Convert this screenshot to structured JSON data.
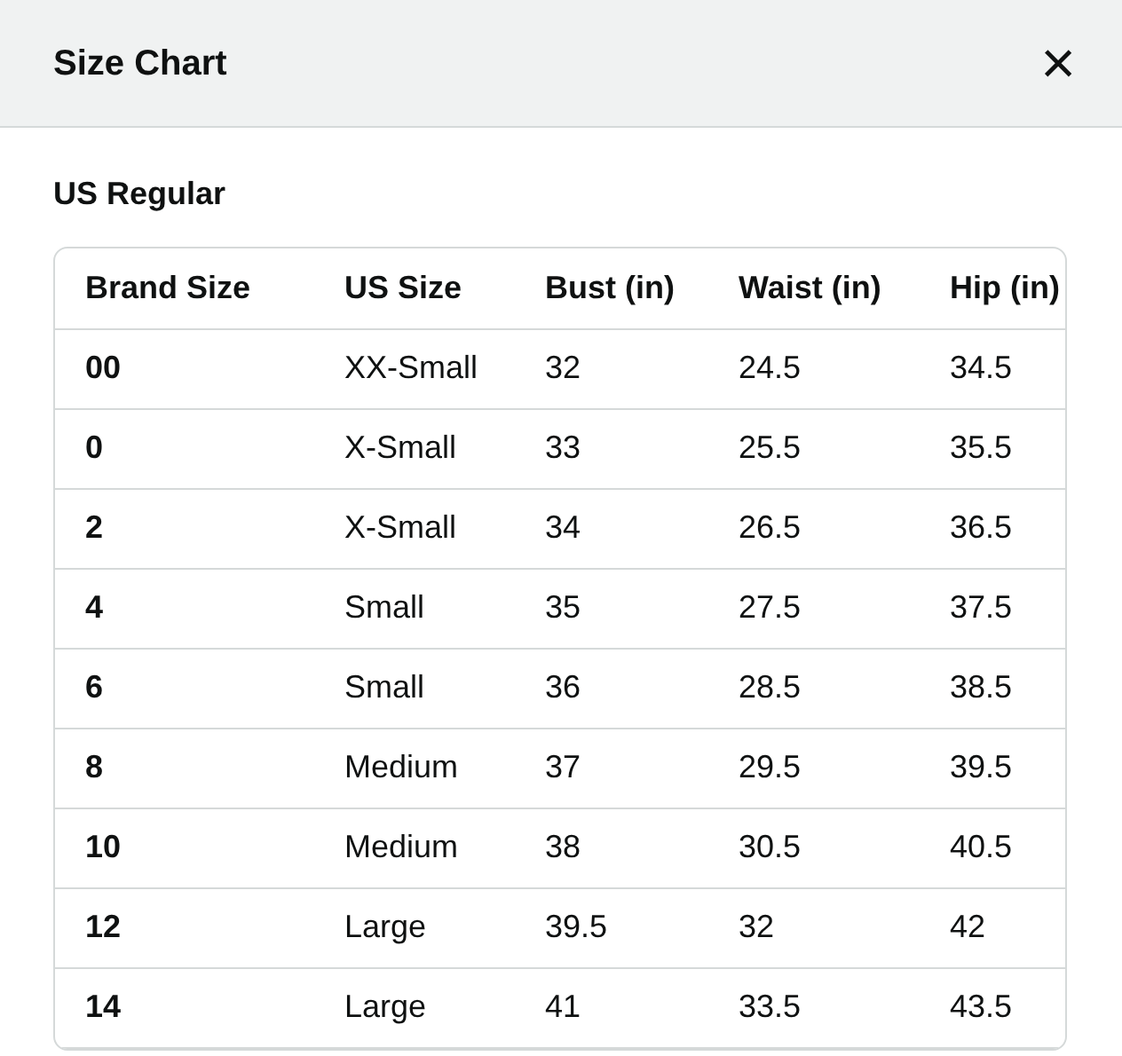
{
  "header": {
    "title": "Size Chart",
    "close": "×"
  },
  "section_title": "US Regular",
  "table": {
    "columns": [
      "Brand Size",
      "US Size",
      "Bust (in)",
      "Waist (in)",
      "Hip (in)"
    ],
    "rows": [
      [
        "00",
        "XX-Small",
        "32",
        "24.5",
        "34.5"
      ],
      [
        "0",
        "X-Small",
        "33",
        "25.5",
        "35.5"
      ],
      [
        "2",
        "X-Small",
        "34",
        "26.5",
        "36.5"
      ],
      [
        "4",
        "Small",
        "35",
        "27.5",
        "37.5"
      ],
      [
        "6",
        "Small",
        "36",
        "28.5",
        "38.5"
      ],
      [
        "8",
        "Medium",
        "37",
        "29.5",
        "39.5"
      ],
      [
        "10",
        "Medium",
        "38",
        "30.5",
        "40.5"
      ],
      [
        "12",
        "Large",
        "39.5",
        "32",
        "42"
      ],
      [
        "14",
        "Large",
        "41",
        "33.5",
        "43.5"
      ]
    ]
  }
}
